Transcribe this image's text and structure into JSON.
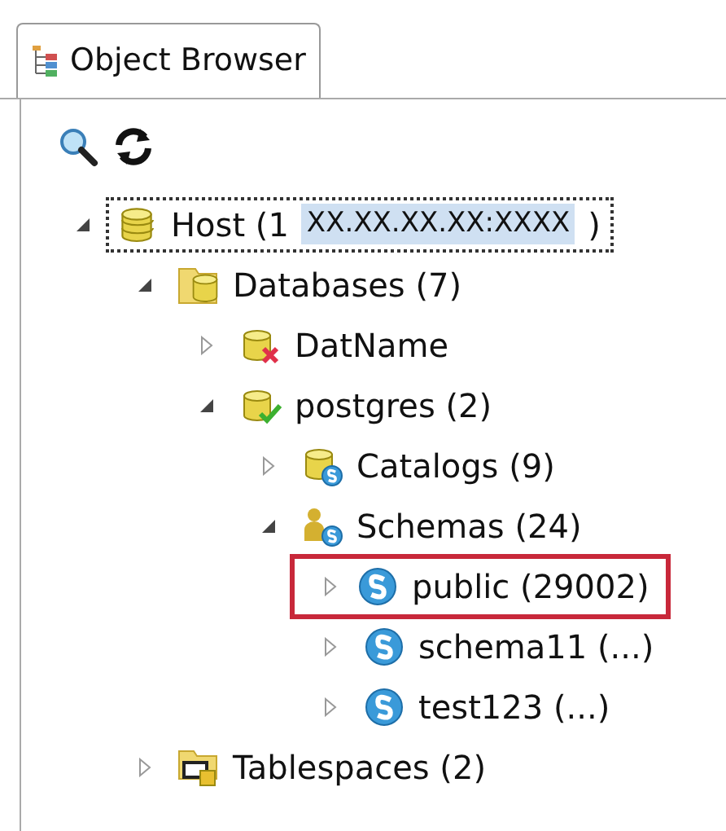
{
  "tab": {
    "label": "Object Browser",
    "selected": true
  },
  "tree": [
    {
      "kind": "host",
      "label": "Host (1",
      "highlight": "XX.XX.XX.XX:XXXX",
      "suffix": ")",
      "expanded": true,
      "focused": true,
      "children": [
        {
          "kind": "databases",
          "label": "Databases (7)",
          "expanded": true,
          "children": [
            {
              "kind": "database-error",
              "label": "DatName",
              "expanded": false
            },
            {
              "kind": "database-ok",
              "label": "postgres (2)",
              "expanded": true,
              "children": [
                {
                  "kind": "catalogs",
                  "label": "Catalogs (9)",
                  "expanded": false
                },
                {
                  "kind": "schemas",
                  "label": "Schemas (24)",
                  "expanded": true,
                  "children": [
                    {
                      "kind": "schema",
                      "label": "public (29002)",
                      "expanded": false,
                      "marked": true
                    },
                    {
                      "kind": "schema",
                      "label": "schema11 (...)",
                      "expanded": false,
                      "marked": false
                    },
                    {
                      "kind": "schema",
                      "label": "test123 (...)",
                      "expanded": false,
                      "marked": false
                    }
                  ]
                }
              ]
            }
          ]
        },
        {
          "kind": "tablespaces",
          "label": "Tablespaces (2)",
          "expanded": false
        }
      ]
    }
  ]
}
